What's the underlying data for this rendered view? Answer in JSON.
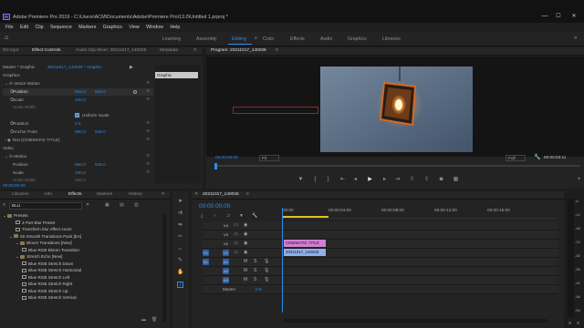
{
  "window": {
    "title": "Adobe Premiere Pro 2019 - C:\\Users\\ACM\\Documents\\Adobe\\Premiere Pro\\13.0\\Untitled 1.prproj *",
    "app_icon": "Pr",
    "minimize": "—",
    "maximize": "☐",
    "close": "✕"
  },
  "menu": [
    "File",
    "Edit",
    "Clip",
    "Sequence",
    "Markers",
    "Graphics",
    "View",
    "Window",
    "Help"
  ],
  "workspaces": [
    "Learning",
    "Assembly",
    "Editing",
    "Color",
    "Effects",
    "Audio",
    "Graphics",
    "Libraries"
  ],
  "workspace_menu_icon": "≡",
  "workspace_active": "Editing",
  "source_panel": {
    "tabs": [
      "f03.mp4",
      "Effect Controls",
      "Audio Clip Mixer: 20211017_140026",
      "Metadata"
    ],
    "active_tab": "Effect Controls",
    "source_label": "Master * Graphic",
    "clip_label": "20211017_140026 * Graphic",
    "mini_timeline_clip": "Graphic",
    "sections": {
      "graphics": "Graphics",
      "vector_motion": "Vector Motion",
      "position": {
        "label": "Position",
        "x": "564.0",
        "y": "540.0"
      },
      "scale": {
        "label": "Scale",
        "value": "100.0"
      },
      "scale_width": {
        "label": "Scale Width",
        "value": ""
      },
      "uniform_scale": "Uniform Scale",
      "rotation": {
        "label": "Rotation",
        "value": "0.0"
      },
      "anchor_point": {
        "label": "Anchor Point",
        "x": "960.0",
        "y": "540.0"
      },
      "text_layer": "Text (CINEMATIC TITLE)",
      "video": "Video",
      "motion": "Motion",
      "position2": {
        "label": "Position",
        "x": "960.0",
        "y": "540.0"
      },
      "scale2": {
        "label": "Scale",
        "value": "100.0"
      },
      "scale_width2": {
        "label": "Scale Width",
        "value": "100.0"
      }
    },
    "timecode": "00:00:00:00"
  },
  "program_monitor": {
    "title": "Program: 20211017_140026",
    "timecode_left": "00:00:00:00",
    "fit": "Fit",
    "quality": "Full",
    "timecode_right": "00:00:03:11"
  },
  "effects_panel": {
    "tabs": [
      "Libraries",
      "Info",
      "Effects",
      "Markers",
      "History"
    ],
    "active_tab": "Effects",
    "search_value": "BLU",
    "items": [
      {
        "label": "Presets",
        "kind": "folder",
        "indent": 0
      },
      {
        "label": "3 Part Blur Preset",
        "kind": "fx",
        "indent": 2
      },
      {
        "label": "Transform blur effect zoom",
        "kind": "fx",
        "indent": 2
      },
      {
        "label": "50 Smooth Transitions Pack [EA]",
        "kind": "folder",
        "indent": 1
      },
      {
        "label": "Bloom Transitions [New]",
        "kind": "folder",
        "indent": 2
      },
      {
        "label": "Blue RGB Bloom Transition",
        "kind": "fx",
        "indent": 3
      },
      {
        "label": "Stretch Echo [New]",
        "kind": "folder",
        "indent": 2
      },
      {
        "label": "Blue RGB Stretch Down",
        "kind": "fx",
        "indent": 3
      },
      {
        "label": "Blue RGB Stretch Horizontal",
        "kind": "fx",
        "indent": 3
      },
      {
        "label": "Blue RGB Stretch Left",
        "kind": "fx",
        "indent": 3
      },
      {
        "label": "Blue RGB Stretch Right",
        "kind": "fx",
        "indent": 3
      },
      {
        "label": "Blue RGB Stretch Up",
        "kind": "fx",
        "indent": 3
      },
      {
        "label": "Blue RGB Stretch Vertical",
        "kind": "fx",
        "indent": 3
      }
    ]
  },
  "timeline": {
    "sequence_tab": "20211017_140026",
    "timecode": "00:00:00:00",
    "ruler": [
      "00:00",
      "00:00:04:00",
      "00:00:08:00",
      "00:00:12:00",
      "00:00:16:00"
    ],
    "video_tracks": [
      "V4",
      "V3",
      "V2",
      "V1"
    ],
    "audio_tracks": [
      "A1",
      "A2",
      "A3"
    ],
    "master": {
      "label": "Master",
      "value": "0.0"
    },
    "clips": {
      "title": "CINEMATIC TITLE",
      "video": "20211017_140026"
    }
  },
  "audio_meter": {
    "scale": [
      "-6",
      "-12",
      "-18",
      "-24",
      "-30",
      "-36",
      "-42",
      "-48",
      "-54"
    ],
    "footer": [
      "S",
      "S"
    ]
  },
  "colors": {
    "accent": "#2d8ceb",
    "title_clip": "#d17fd1",
    "video_clip": "#8fb0e8"
  }
}
